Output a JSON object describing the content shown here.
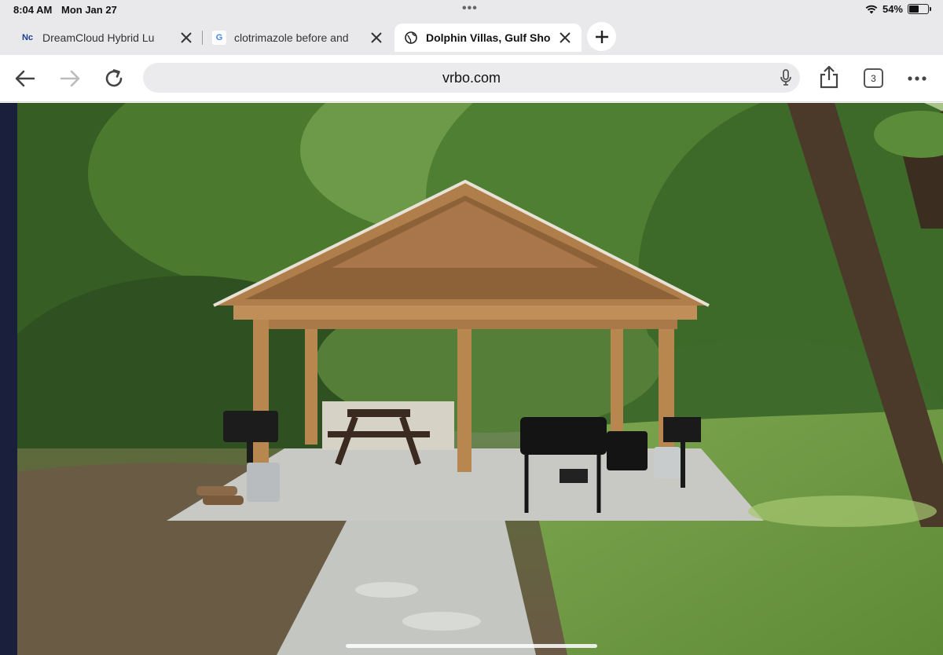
{
  "status_bar": {
    "time": "8:04 AM",
    "date": "Mon Jan 27",
    "battery_percent": "54%",
    "battery_level": 0.54
  },
  "tabs": [
    {
      "title": "DreamCloud Hybrid Lu",
      "favicon": "dreamcloud-logo",
      "favicon_text": "Nc"
    },
    {
      "title": "clotrimazole before and",
      "favicon": "google-logo",
      "favicon_text": "G"
    },
    {
      "title": "Dolphin Villas, Gulf Sho",
      "favicon": "globe-icon",
      "active": true
    }
  ],
  "toolbar": {
    "url": "vrbo.com",
    "tab_count": "3"
  },
  "colors": {
    "chrome_bg": "#e9e9ec",
    "url_bg": "#ebebee",
    "page_side": "#1a1f3b"
  }
}
